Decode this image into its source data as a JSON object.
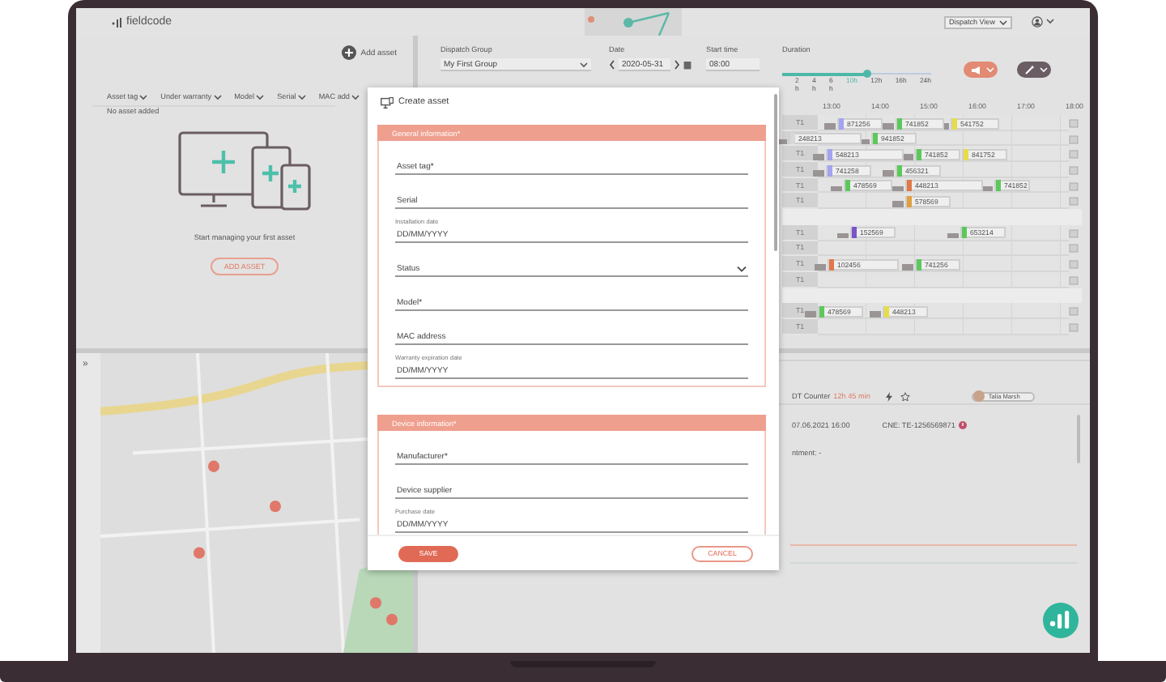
{
  "header": {
    "logo": "fieldcode",
    "view_select": "Dispatch View"
  },
  "assets": {
    "add_button": "Add asset",
    "columns": [
      "Asset tag",
      "Under warranty",
      "Model",
      "Serial",
      "MAC add"
    ],
    "empty_text": "No asset added",
    "prompt": "Start managing your first asset",
    "add_asset_button": "ADD ASSET"
  },
  "map": {
    "toggle": "»"
  },
  "dispatch": {
    "group_label": "Dispatch Group",
    "group_value": "My First Group",
    "date_label": "Date",
    "date_value": "2020-05-31",
    "start_label": "Start time",
    "start_value": "08:00",
    "duration_label": "Duration",
    "duration_level": {
      "level": 0.57
    },
    "duration_steps": [
      {
        "value": "2",
        "unit": "h",
        "selected": false
      },
      {
        "value": "4",
        "unit": "h",
        "selected": false
      },
      {
        "value": "6",
        "unit": "h",
        "selected": false
      },
      {
        "value": "10h",
        "selected": true
      },
      {
        "value": "12h",
        "selected": false
      },
      {
        "value": "16h",
        "selected": false
      },
      {
        "value": "24h",
        "selected": false
      }
    ],
    "time_columns": [
      "13:00",
      "14:00",
      "15:00",
      "16:00",
      "17:00",
      "18:00"
    ],
    "rows": [
      {
        "kind": "resource",
        "label": "T1",
        "jobs": [
          {
            "id": "871256",
            "color": "#a3a3f0"
          },
          {
            "id": "741852",
            "color": "#5cc85c"
          },
          {
            "id": "541752",
            "color": "#e6dc4a"
          }
        ]
      },
      {
        "kind": "resource",
        "jobs": [
          {
            "id": "248213",
            "color": "#d8d8d8"
          },
          {
            "id": "941852",
            "color": "#5cc85c"
          }
        ]
      },
      {
        "kind": "resource",
        "label": "T1",
        "jobs": [
          {
            "id": "548213",
            "color": "#a3a3f0"
          },
          {
            "id": "741852",
            "color": "#5cc85c"
          },
          {
            "id": "841752",
            "color": "#e6dc4a"
          }
        ]
      },
      {
        "kind": "resource",
        "label": "T1",
        "jobs": [
          {
            "id": "741258",
            "color": "#a3a3f0"
          },
          {
            "id": "456321",
            "color": "#5cc85c"
          }
        ]
      },
      {
        "kind": "resource",
        "label": "T1",
        "jobs": [
          {
            "id": "478569",
            "color": "#5cc85c"
          },
          {
            "id": "448213",
            "color": "#e0784a"
          },
          {
            "id": "741852",
            "color": "#5cc85c"
          }
        ]
      },
      {
        "kind": "resource",
        "label": "T1",
        "jobs": [
          {
            "id": "578569",
            "color": "#e0a040"
          }
        ]
      },
      {
        "kind": "gap"
      },
      {
        "kind": "resource",
        "label": "T1",
        "jobs": [
          {
            "id": "152569",
            "color": "#7a55c8"
          },
          {
            "id": "653214",
            "color": "#5cc85c"
          }
        ]
      },
      {
        "kind": "resource",
        "label": "T1",
        "jobs": []
      },
      {
        "kind": "resource",
        "label": "T1",
        "jobs": [
          {
            "id": "102456",
            "color": "#e0784a"
          },
          {
            "id": "741256",
            "color": "#5cc85c"
          }
        ]
      },
      {
        "kind": "resource",
        "label": "T1",
        "jobs": []
      },
      {
        "kind": "gap"
      },
      {
        "kind": "resource",
        "label": "T1",
        "jobs": [
          {
            "id": "478569",
            "color": "#5cc85c"
          },
          {
            "id": "448213",
            "color": "#e6dc4a"
          }
        ]
      },
      {
        "kind": "resource",
        "label": "T1",
        "jobs": []
      }
    ]
  },
  "detail": {
    "counter_label": "DT Counter",
    "counter_value": "12h 45 min",
    "assignee": "Talia Marsh",
    "datetime": "07.06.2021 16:00",
    "cne": "CNE: TE-1256569871",
    "appointment": "ntment: -"
  },
  "modal": {
    "title": "Create asset",
    "sections": [
      {
        "title": "General information*",
        "fields": [
          {
            "kind": "text",
            "placeholder": "Asset tag*"
          },
          {
            "kind": "text",
            "placeholder": "Serial"
          },
          {
            "kind": "date",
            "label": "Installation date",
            "placeholder": "DD/MM/YYYY"
          },
          {
            "kind": "select",
            "value": "Status"
          },
          {
            "kind": "text",
            "placeholder": "Model*"
          },
          {
            "kind": "text",
            "placeholder": "MAC address"
          },
          {
            "kind": "date",
            "label": "Warranty expiration date",
            "placeholder": "DD/MM/YYYY"
          }
        ]
      },
      {
        "title": "Device information*",
        "fields": [
          {
            "kind": "text",
            "placeholder": "Manufacturer*"
          },
          {
            "kind": "text",
            "placeholder": "Device supplier"
          },
          {
            "kind": "date",
            "label": "Purchase date",
            "placeholder": "DD/MM/YYYY"
          }
        ]
      }
    ],
    "save": "SAVE",
    "cancel": "CANCEL"
  }
}
